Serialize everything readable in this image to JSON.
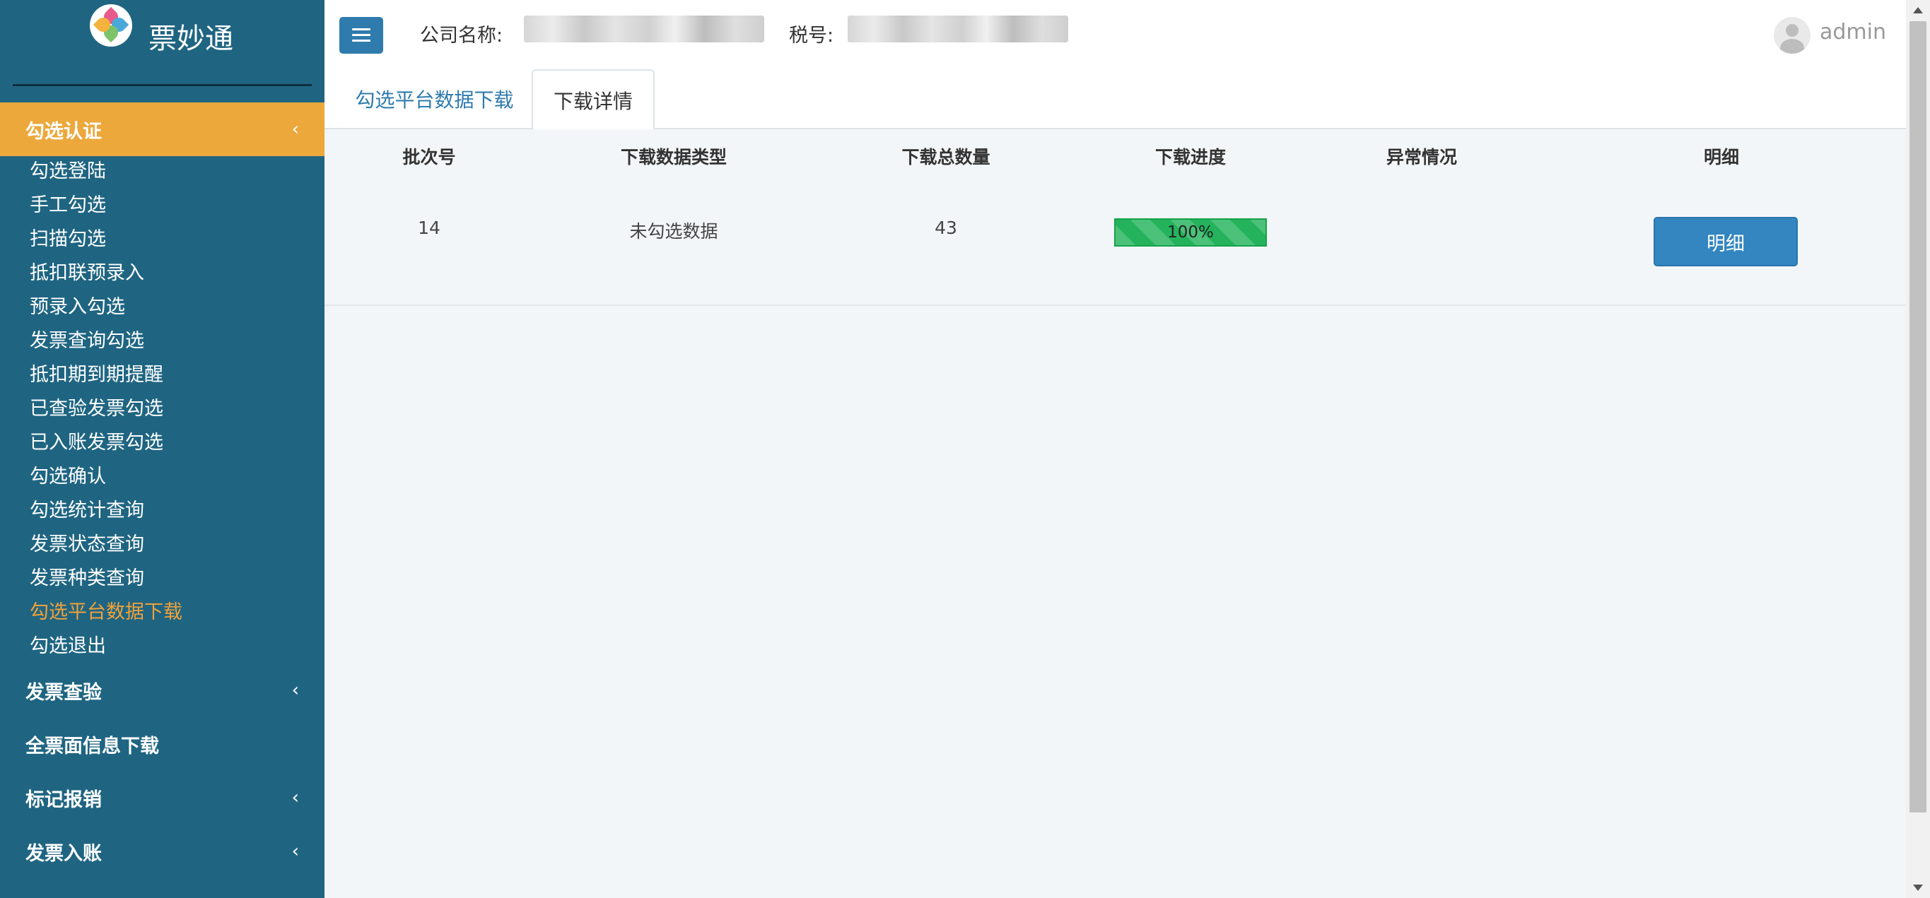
{
  "brand": {
    "name": "票妙通"
  },
  "sidebar": {
    "sections": [
      {
        "label": "勾选认证",
        "chevron": "‹",
        "active": true
      },
      {
        "label": "发票查验",
        "chevron": "‹"
      },
      {
        "label": "全票面信息下载",
        "chevron": ""
      },
      {
        "label": "标记报销",
        "chevron": "‹"
      },
      {
        "label": "发票入账",
        "chevron": "‹"
      }
    ],
    "items": [
      "勾选登陆",
      "手工勾选",
      "扫描勾选",
      "抵扣联预录入",
      "预录入勾选",
      "发票查询勾选",
      "抵扣期到期提醒",
      "已查验发票勾选",
      "已入账发票勾选",
      "勾选确认",
      "勾选统计查询",
      "发票状态查询",
      "发票种类查询",
      "勾选平台数据下载",
      "勾选退出"
    ],
    "current_item": "勾选平台数据下载"
  },
  "header": {
    "company_label": "公司名称:",
    "tax_label": "税号:",
    "username": "admin"
  },
  "tabs": [
    {
      "label": "勾选平台数据下载",
      "active": false
    },
    {
      "label": "下载详情",
      "active": true
    }
  ],
  "table": {
    "columns": [
      "批次号",
      "下载数据类型",
      "下载总数量",
      "下载进度",
      "异常情况",
      "明细"
    ],
    "rows": [
      {
        "batch": "14",
        "type": "未勾选数据",
        "total": "43",
        "progress_label": "100%",
        "progress": 1.0,
        "exception": "",
        "detail_button": "明细"
      }
    ]
  },
  "colors": {
    "sidebar_bg": "#1f6582",
    "active_section": "#eca83b",
    "current_item": "#f0a13a",
    "primary": "#2f7bad",
    "progress": "#24b35c"
  },
  "icons": [
    "hamburger-icon",
    "chevron-left-icon",
    "avatar-icon",
    "logo-icon"
  ]
}
